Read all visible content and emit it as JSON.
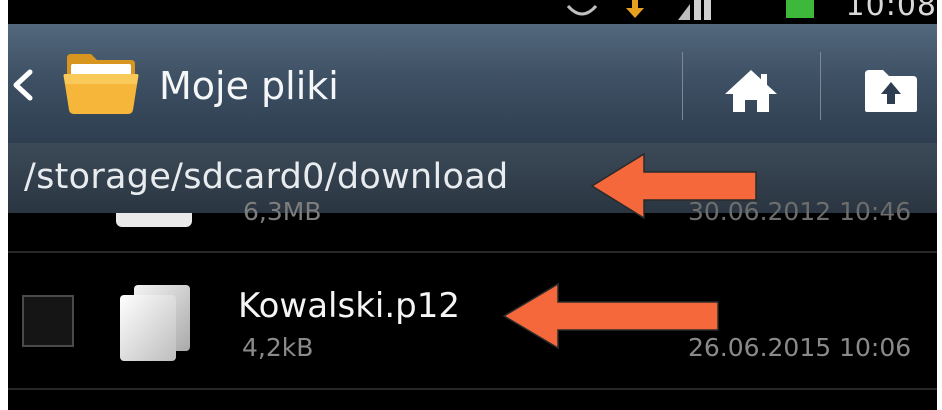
{
  "app": {
    "title": "Moje pliki",
    "path": "/storage/sdcard0/download"
  },
  "icons": {
    "back": "back-chevron-icon",
    "app": "folder-icon",
    "home": "home-icon",
    "up": "folder-up-icon",
    "file": "generic-file-icon",
    "annotation": "orange-arrow-icon"
  },
  "files": [
    {
      "size": "6,3MB",
      "date": "30.06.2012 10:46"
    },
    {
      "name": "Kowalski.p12",
      "size": "4,2kB",
      "date": "26.06.2015 10:06"
    }
  ],
  "colors": {
    "actionbar": "#3e5064",
    "pathbar": "#2f3b47",
    "arrow": "#f4683c",
    "folder": "#f5b63a"
  }
}
